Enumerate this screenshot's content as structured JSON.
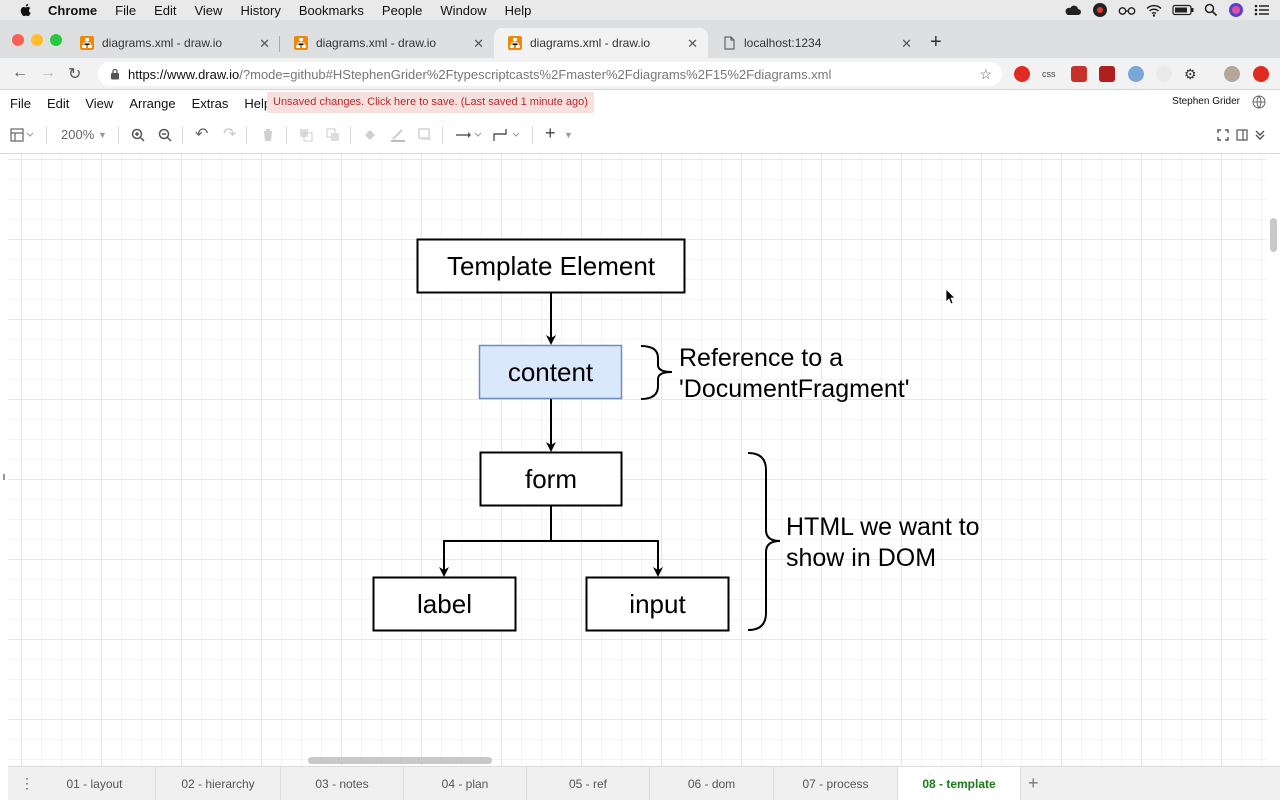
{
  "mac_menu": {
    "app": "Chrome",
    "items": [
      "File",
      "Edit",
      "View",
      "History",
      "Bookmarks",
      "People",
      "Window",
      "Help"
    ]
  },
  "browser": {
    "tabs": [
      {
        "title": "diagrams.xml - draw.io",
        "icon": "drawio-favicon"
      },
      {
        "title": "diagrams.xml - draw.io",
        "icon": "drawio-favicon"
      },
      {
        "title": "diagrams.xml - draw.io",
        "icon": "drawio-favicon",
        "active": true
      },
      {
        "title": "localhost:1234",
        "icon": "page-icon"
      }
    ],
    "url_host": "https://www.draw.io",
    "url_rest": "/?mode=github#HStephenGrider%2Ftypescriptcasts%2Fmaster%2Fdiagrams%2F15%2Fdiagrams.xml"
  },
  "drawio_menu": {
    "items": [
      "File",
      "Edit",
      "View",
      "Arrange",
      "Extras",
      "Help"
    ],
    "unsaved": "Unsaved changes. Click here to save. (Last saved 1 minute ago)",
    "user": "Stephen Grider"
  },
  "toolbar": {
    "zoom": "200%"
  },
  "diagram": {
    "nodes": {
      "template": "Template Element",
      "content": "content",
      "form": "form",
      "label": "label",
      "input": "input"
    },
    "notes": {
      "ref_line1": "Reference to a",
      "ref_line2": "'DocumentFragment'",
      "html_line1": "HTML we want to",
      "html_line2": "show in DOM"
    },
    "colors": {
      "content_fill": "#dae8fc",
      "content_stroke": "#6c8ebf"
    }
  },
  "pages": [
    "01 - layout",
    "02 - hierarchy",
    "03 - notes",
    "04 - plan",
    "05 - ref",
    "06 - dom",
    "07 - process",
    "08 - template"
  ],
  "active_page": "08 - template"
}
